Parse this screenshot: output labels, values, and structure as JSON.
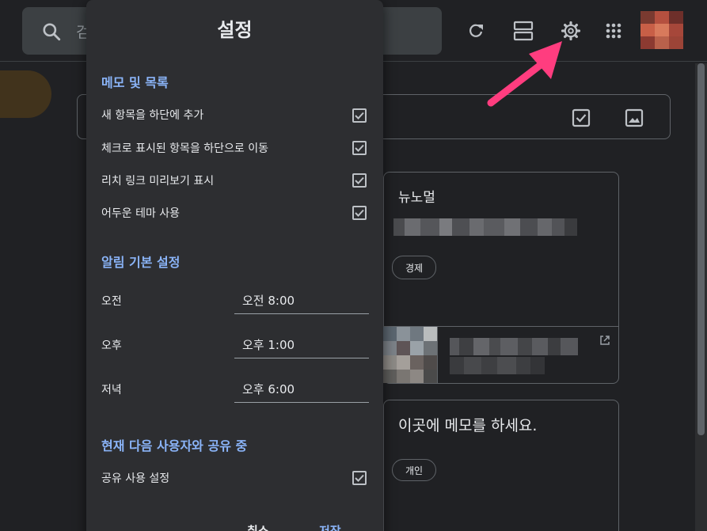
{
  "header": {
    "search_placeholder": "검",
    "icons": [
      "search-icon",
      "refresh-icon",
      "list-view-icon",
      "settings-gear-icon",
      "apps-grid-icon",
      "account-avatar"
    ]
  },
  "take_note": {
    "icons": [
      "checkbox-icon",
      "image-icon"
    ]
  },
  "notes": [
    {
      "title": "뉴노멀",
      "label": "경제"
    },
    {
      "title": "이곳에 메모를 하세요.",
      "label": "개인"
    }
  ],
  "settings_dialog": {
    "title": "설정",
    "sections": {
      "notes_lists": {
        "title": "메모 및 목록",
        "items": [
          {
            "label": "새 항목을 하단에 추가",
            "checked": true
          },
          {
            "label": "체크로 표시된 항목을 하단으로 이동",
            "checked": true
          },
          {
            "label": "리치 링크 미리보기 표시",
            "checked": true
          },
          {
            "label": "어두운 테마 사용",
            "checked": true
          }
        ]
      },
      "reminders": {
        "title": "알림 기본 설정",
        "times": [
          {
            "label": "오전",
            "value": "오전 8:00"
          },
          {
            "label": "오후",
            "value": "오후 1:00"
          },
          {
            "label": "저녁",
            "value": "오후 6:00"
          }
        ]
      },
      "sharing": {
        "title": "현재 다음 사용자와 공유 중",
        "items": [
          {
            "label": "공유 사용 설정",
            "checked": true
          }
        ]
      }
    },
    "buttons": {
      "cancel": "취소",
      "save": "저장"
    }
  },
  "colors": {
    "background": "#202124",
    "dialog": "#2d2e31",
    "accent_blue": "#8ab4f8",
    "annotation_arrow": "#ff3d7f"
  }
}
